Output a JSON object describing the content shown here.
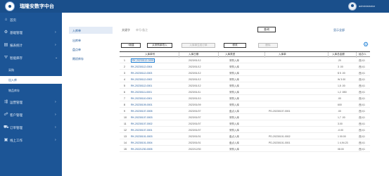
{
  "header": {
    "app_title": "瑞隆安数字中台",
    "user_name": "administrator"
  },
  "sidebar": {
    "items": [
      {
        "label": "首页",
        "icon": "home-icon",
        "glyph": "⌂",
        "chevron": ""
      },
      {
        "label": "基础管理",
        "icon": "gear-icon",
        "glyph": "⚙",
        "chevron": "›"
      },
      {
        "label": "报表统计",
        "icon": "chart-icon",
        "glyph": "▤",
        "chevron": "›"
      },
      {
        "label": "智能库存",
        "icon": "filter-icon",
        "glyph": "⛛",
        "chevron": "⌄"
      }
    ],
    "sub_items": [
      {
        "label": "采购"
      },
      {
        "label": "出入库"
      },
      {
        "label": "物品库存"
      }
    ],
    "items_bottom": [
      {
        "label": "运营管理",
        "icon": "tasks-icon",
        "glyph": "⇶",
        "chevron": "›"
      },
      {
        "label": "客户管理",
        "icon": "handshake-icon",
        "glyph": "☍",
        "chevron": "›"
      },
      {
        "label": "订单管理",
        "icon": "cart-icon",
        "glyph": "⛟",
        "chevron": "›"
      },
      {
        "label": "线上工作",
        "icon": "window-icon",
        "glyph": "▣",
        "chevron": "›"
      }
    ]
  },
  "subnav": {
    "items": [
      {
        "label": "入库单"
      },
      {
        "label": "出库单"
      },
      {
        "label": "盘点单"
      },
      {
        "label": "期初库存"
      }
    ]
  },
  "filter": {
    "label": "关键字",
    "value": "单号/备注",
    "search_label": "查询",
    "show_all_label": "显示全部"
  },
  "toolbar": {
    "new_label": "+新建",
    "import_po_label": "从采购单导入",
    "to_order_label": "入库单生成订单",
    "modify_label": "修改",
    "delete_label": "删除"
  },
  "grid": {
    "columns": [
      "入库单号",
      "入库日期",
      "入库类型",
      "入库单",
      "入库总金额",
      "经办人"
    ],
    "rows": [
      {
        "idx": "1",
        "no": "RK-20230112-0005",
        "date": "2023/01/12",
        "type": "采购入库",
        "ref": "",
        "amount": "",
        "operator": "西川1",
        "amount_tail": ".20"
      },
      {
        "idx": "2",
        "no": "RK-20230112-0004",
        "date": "2023/01/12",
        "type": "采购入库",
        "ref": "",
        "amount": "",
        "operator": "西川1",
        "amount_tail": "3 .00"
      },
      {
        "idx": "3",
        "no": "RK-20230112-0003",
        "date": "2023/01/12",
        "type": "采购入库",
        "ref": "",
        "amount": "",
        "operator": "西川1",
        "amount_tail": "$ 5 .00"
      },
      {
        "idx": "4",
        "no": "RK-20230112-0002",
        "date": "2023/01/12",
        "type": "采购入库",
        "ref": "",
        "amount": "",
        "operator": "西川1",
        "amount_tail": "W 3.00"
      },
      {
        "idx": "5",
        "no": "RK-20230112-0001",
        "date": "2023/01/12",
        "type": "采购入库",
        "ref": "",
        "amount": "",
        "operator": "西川1",
        "amount_tail": "1,5 .00"
      },
      {
        "idx": "6",
        "no": "RK-20230111-0001",
        "date": "2023/01/11",
        "type": "采购入库",
        "ref": "",
        "amount": "",
        "operator": "西川1",
        "amount_tail": "1,2 .550"
      },
      {
        "idx": "7",
        "no": "RK-20230110-0001",
        "date": "2023/01/10",
        "type": "采购入库",
        "ref": "",
        "amount": "",
        "operator": "西川1",
        "amount_tail": ".00"
      },
      {
        "idx": "8",
        "no": "RK-20230109-0001",
        "date": "2023/01/09",
        "type": "采购入库",
        "ref": "",
        "amount": "",
        "operator": "西川1",
        "amount_tail": "600"
      },
      {
        "idx": "9",
        "no": "RK-20230107-0005",
        "date": "2023/01/07",
        "type": "盘点入库",
        "ref": "PD-20230107-0001",
        "amount": "",
        "operator": "西川1",
        "amount_tail": ".00"
      },
      {
        "idx": "10",
        "no": "RK-20230107-0003",
        "date": "2023/01/07",
        "type": "采购入库",
        "ref": "",
        "amount": "",
        "operator": "西川1",
        "amount_tail": "1,7 .00"
      },
      {
        "idx": "11",
        "no": "RK-20230107-0002",
        "date": "2023/01/07",
        "type": "采购入库",
        "ref": "",
        "amount": "",
        "operator": "西川1",
        "amount_tail": "3.00"
      },
      {
        "idx": "12",
        "no": "RK-20230107-0001",
        "date": "2023/01/07",
        "type": "采购入库",
        "ref": "",
        "amount": "",
        "operator": "西川1",
        "amount_tail": "-0.00"
      },
      {
        "idx": "13",
        "no": "RK-20230101-0003",
        "date": "2023/01/01",
        "type": "盘点入库",
        "ref": "PD-20230101-0002",
        "amount": "",
        "operator": "西川1",
        "amount_tail": "1 00.00"
      },
      {
        "idx": "14",
        "no": "RK-20230101-0004",
        "date": "2023/01/01",
        "type": "盘点入库",
        "ref": "PD-20230101-0001",
        "amount": "",
        "operator": "西川1",
        "amount_tail": "1 4,94.23"
      },
      {
        "idx": "15",
        "no": "RK-20221230-0005",
        "date": "2022/12/30",
        "type": "采购入库",
        "ref": "",
        "amount": "",
        "operator": "西川1",
        "amount_tail": "08.00"
      }
    ]
  },
  "colors": {
    "brand": "#1a4f8b",
    "sidebar": "#1c5596",
    "accent": "#1c7fd6"
  }
}
